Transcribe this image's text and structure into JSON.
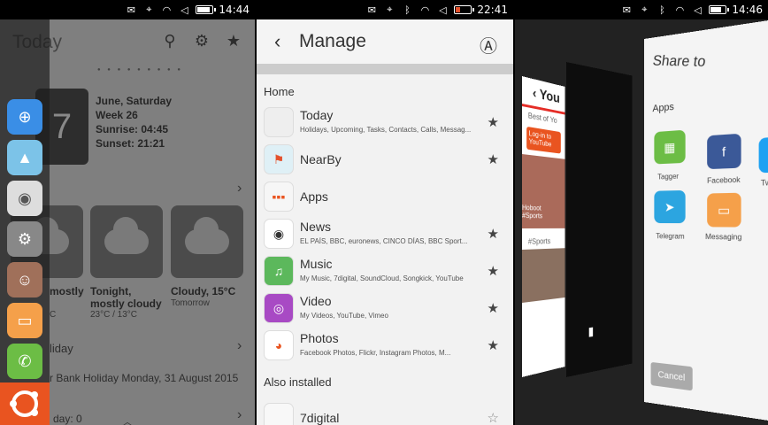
{
  "panels": [
    {
      "status": {
        "time": "14:44"
      },
      "header": {
        "title": "Today",
        "icons": [
          "search-icon",
          "settings-icon",
          "star-icon"
        ]
      },
      "calendar": {
        "day_number": "7",
        "line1": "June, Saturday",
        "line2": "Week 26",
        "line3": "Sunrise: 04:45",
        "line4": "Sunset: 21:21"
      },
      "weather": [
        {
          "title": "mostly",
          "sub": "C"
        },
        {
          "title": "Tonight, mostly cloudy",
          "sub": "23°C / 13°C"
        },
        {
          "title": "Cloudy, 15°C",
          "sub": "Tomorrow"
        }
      ],
      "holiday": {
        "heading": "liday",
        "text": "r Bank Holiday Monday, 31 August 2015",
        "footer": "day: 0"
      },
      "launcher": {
        "apps": [
          "browser-icon",
          "gallery-icon",
          "camera-icon",
          "settings-icon",
          "contacts-icon",
          "messaging-icon",
          "phone-icon"
        ]
      }
    },
    {
      "status": {
        "time": "22:41"
      },
      "header": {
        "title": "Manage"
      },
      "sections": {
        "home": "Home",
        "also": "Also installed"
      },
      "rows": [
        {
          "title": "Today",
          "sub": "Holidays, Upcoming, Tasks, Contacts, Calls, Messag..."
        },
        {
          "title": "NearBy",
          "sub": ""
        },
        {
          "title": "Apps",
          "sub": ""
        },
        {
          "title": "News",
          "sub": "EL PAÍS, BBC, euronews, CINCO DÍAS, BBC Sport..."
        },
        {
          "title": "Music",
          "sub": "My Music, 7digital, SoundCloud, Songkick, YouTube"
        },
        {
          "title": "Video",
          "sub": "My Videos, YouTube, Vimeo"
        },
        {
          "title": "Photos",
          "sub": "Facebook Photos, Flickr, Instagram Photos, M..."
        },
        {
          "title": "7digital",
          "sub": ""
        }
      ]
    },
    {
      "status": {
        "time": "14:46"
      },
      "youtube": {
        "logo": "You",
        "best": "Best of Yo",
        "login": "Log-in to YouTube",
        "caption1": "Hoboot",
        "caption2": "#Sports",
        "section": "#Sports"
      },
      "share": {
        "title": "Share to",
        "apps_label": "Apps",
        "apps": [
          {
            "label": "Tagger",
            "color": "#6cbd45"
          },
          {
            "label": "Facebook",
            "color": "#3b5998"
          },
          {
            "label": "Twi",
            "color": "#1da1f2"
          },
          {
            "label": "Telegram",
            "color": "#2ca5e0"
          },
          {
            "label": "Messaging",
            "color": "#f5a04a"
          }
        ],
        "cancel": "Cancel"
      }
    }
  ]
}
